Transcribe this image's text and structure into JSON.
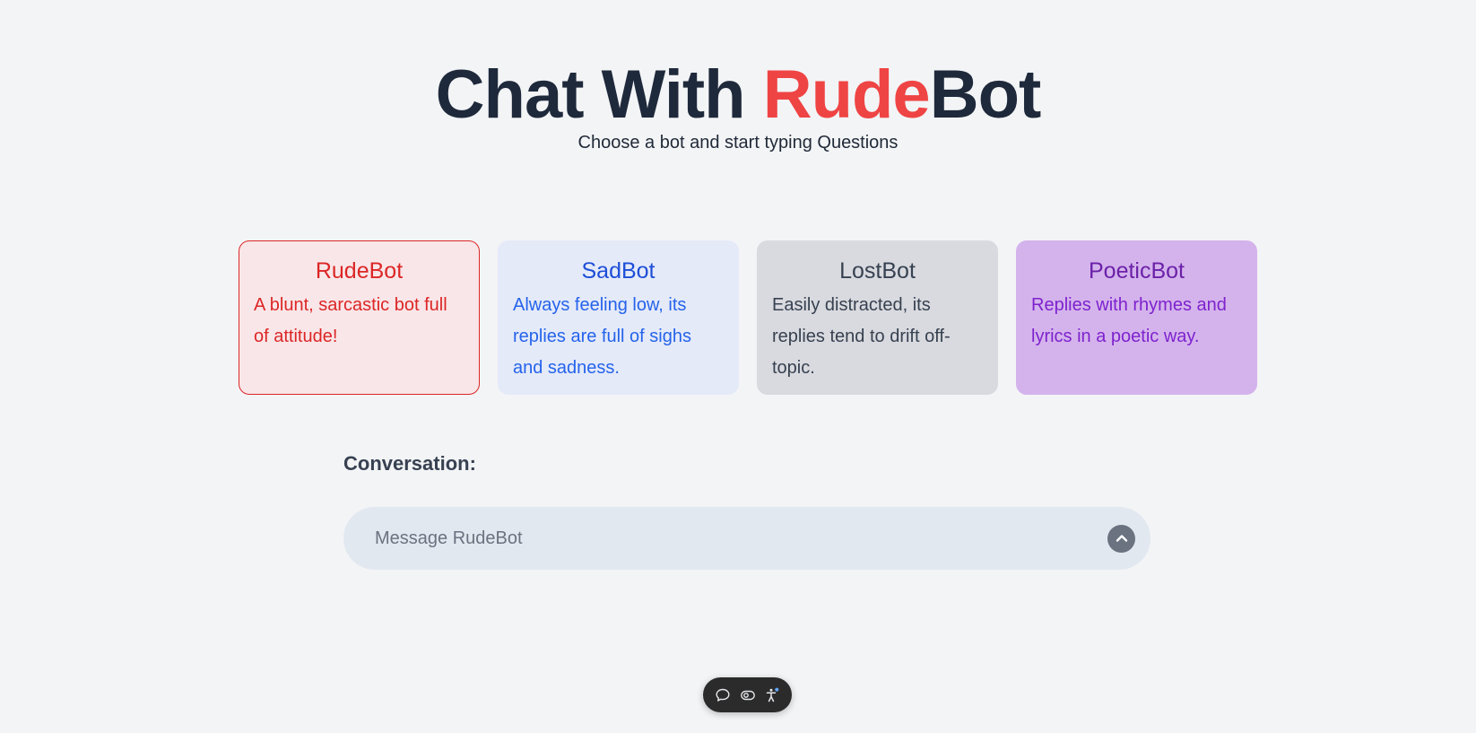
{
  "hero": {
    "title_part1": "Chat With ",
    "title_accent": "Rude",
    "title_part2": "Bot",
    "subtitle": "Choose a bot and start typing Questions"
  },
  "bots": [
    {
      "name": "RudeBot",
      "description": "A blunt, sarcastic bot full of attitude!",
      "selected": true,
      "color": "#dc2626"
    },
    {
      "name": "SadBot",
      "description": "Always feeling low, its replies are full of sighs and sadness.",
      "selected": false,
      "color": "#1d4ed8"
    },
    {
      "name": "LostBot",
      "description": "Easily distracted, its replies tend to drift off-topic.",
      "selected": false,
      "color": "#374151"
    },
    {
      "name": "PoeticBot",
      "description": "Replies with rhymes and lyrics in a poetic way.",
      "selected": false,
      "color": "#6b21a8"
    }
  ],
  "conversation": {
    "label": "Conversation:",
    "input_value": "",
    "input_placeholder": "Message RudeBot",
    "send_icon": "chevron-up-icon"
  },
  "toolbar": {
    "icons": [
      "chat-bubble-icon",
      "toggle-eye-icon",
      "accessibility-icon"
    ]
  },
  "colors": {
    "accent": "#ef4444",
    "background": "#f3f4f6",
    "heading": "#1e293b"
  }
}
